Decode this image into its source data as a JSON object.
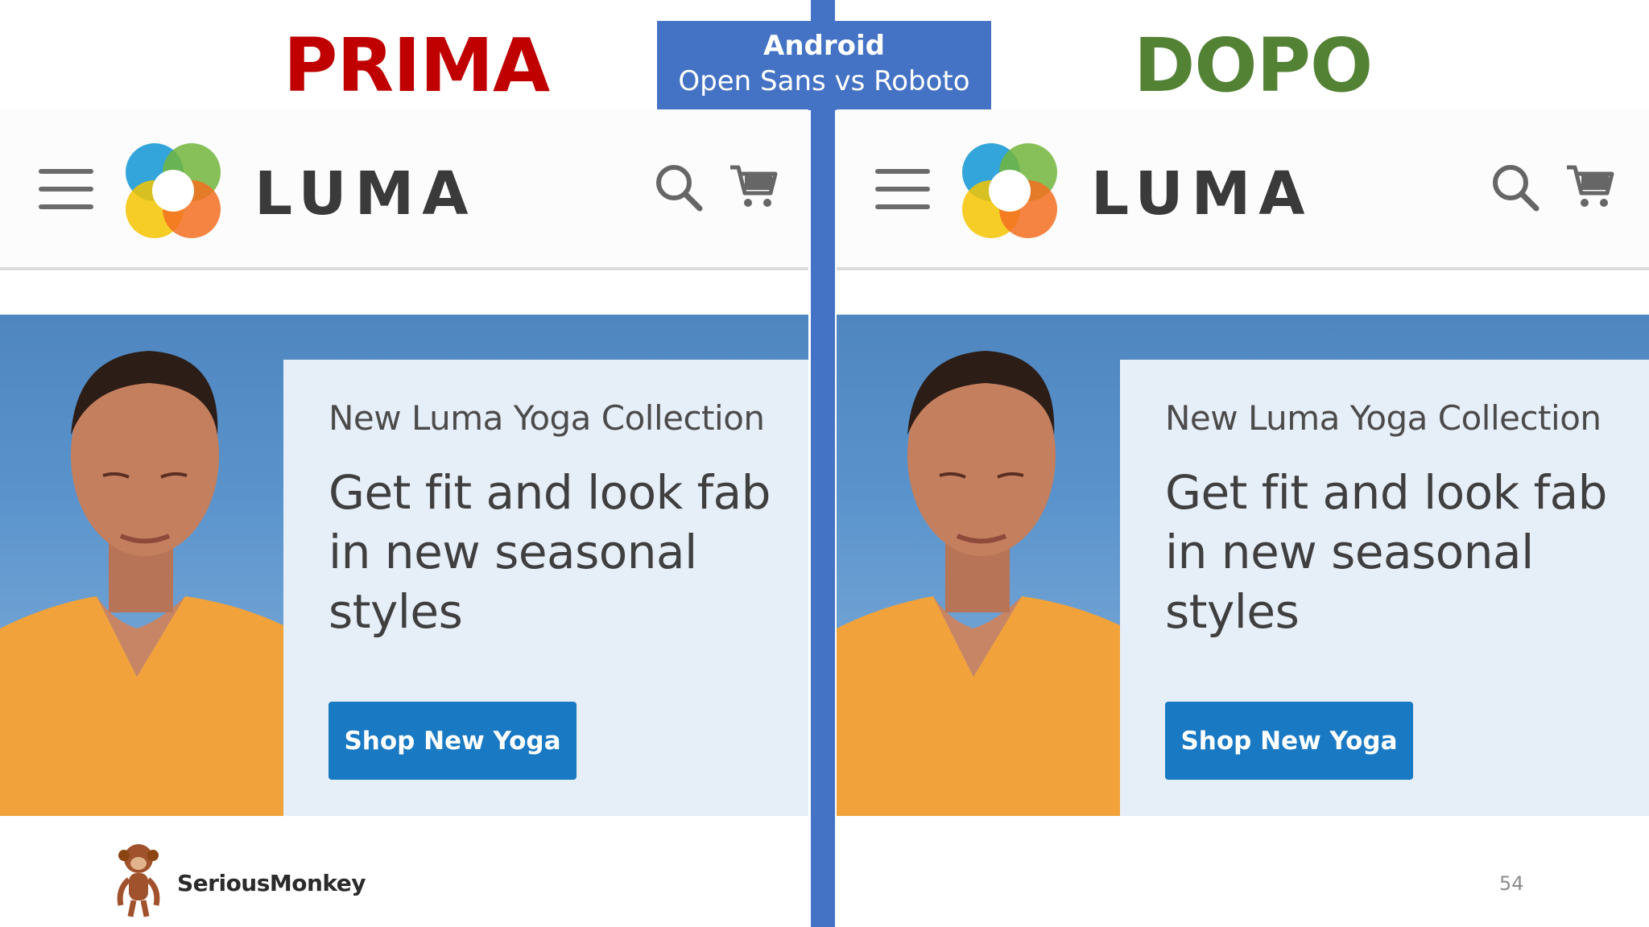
{
  "slide": {
    "title_left": "PRIMA",
    "title_right": "DOPO",
    "caption_line1": "Android",
    "caption_line2": "Open Sans vs Roboto",
    "page_number": "54",
    "footer_brand": "SeriousMonkey"
  },
  "panels": [
    {
      "brand": "LUMA",
      "promo_kicker": "New Luma Yoga Collection",
      "promo_headline": "Get fit and look fab in new seasonal styles",
      "promo_button": "Shop New Yoga"
    },
    {
      "brand": "LUMA",
      "promo_kicker": "New Luma Yoga Collection",
      "promo_headline": "Get fit and look fab in new seasonal styles",
      "promo_button": "Shop New Yoga"
    }
  ],
  "colors": {
    "title_left": "#c00000",
    "title_right": "#548235",
    "accent_blue": "#4472c4",
    "button_blue": "#1979c3"
  },
  "icons": [
    "menu-icon",
    "luma-logo",
    "search-icon",
    "cart-icon",
    "monkey-logo"
  ]
}
